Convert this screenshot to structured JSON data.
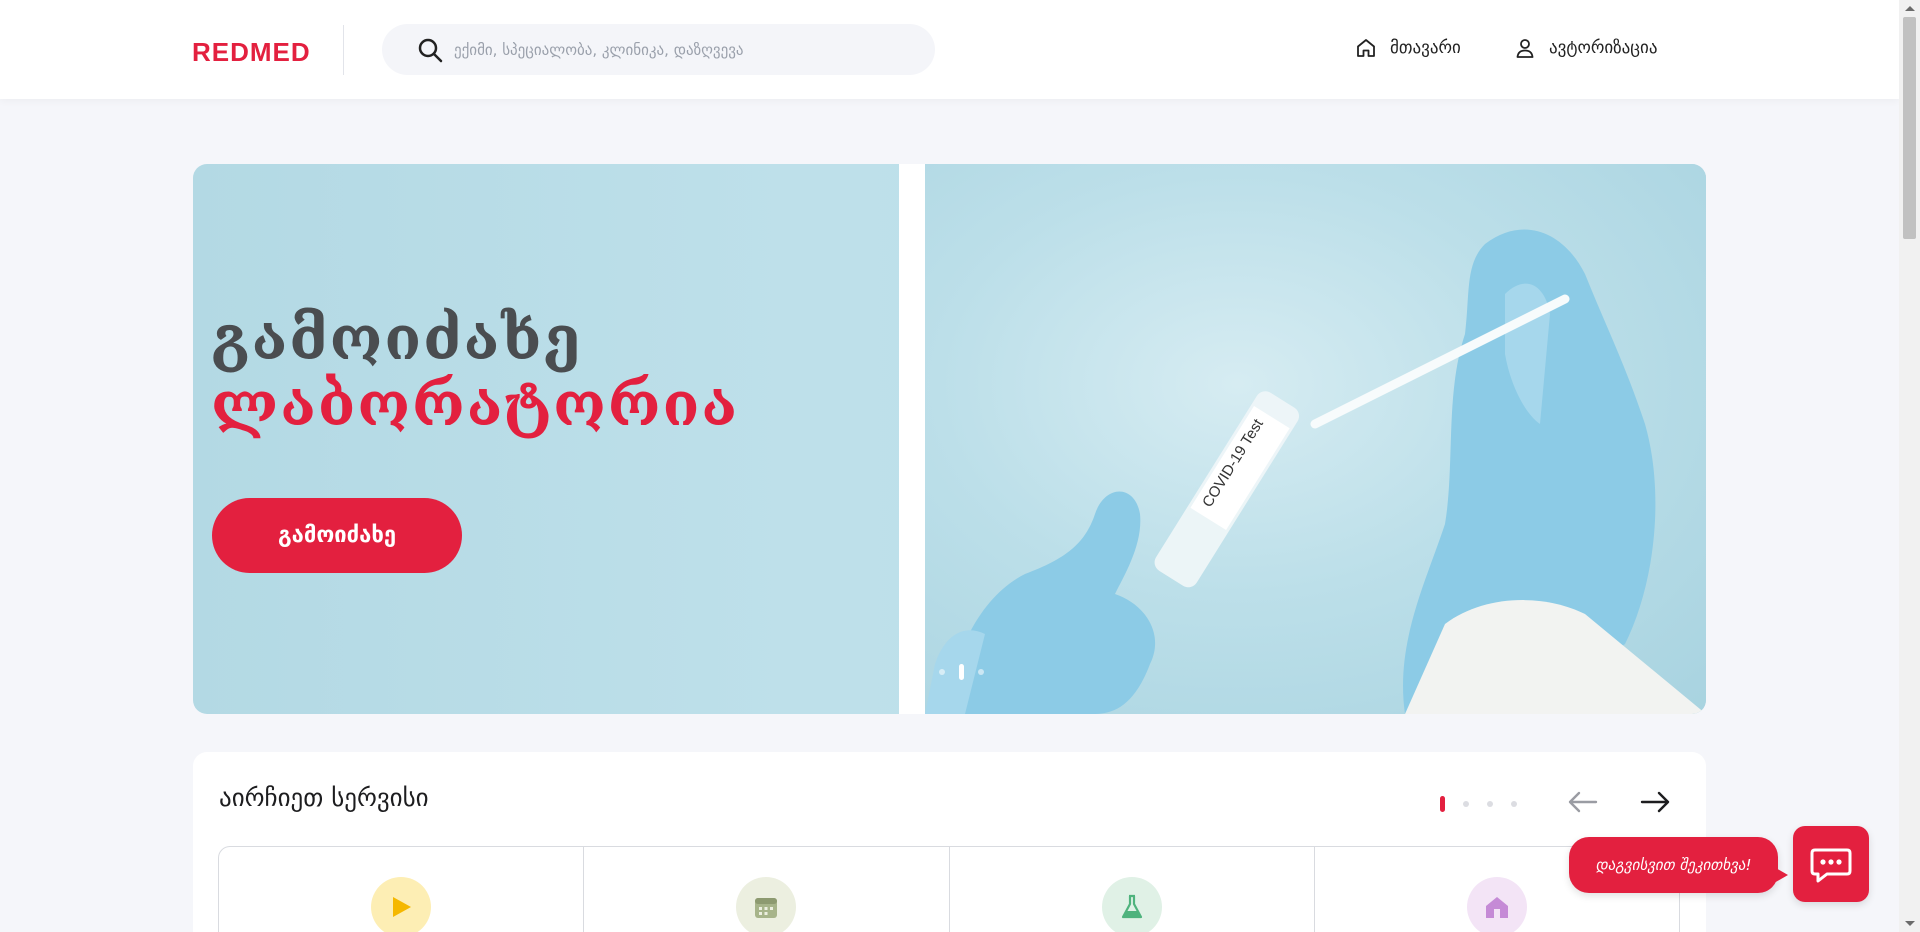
{
  "header": {
    "logo": "REDMED",
    "search": {
      "placeholder": "ექიმი, სპეციალობა, კლინიკა, დაზღვევა",
      "icon": "search-icon"
    },
    "nav": [
      {
        "label": "მთავარი",
        "icon": "home-icon"
      },
      {
        "label": "ავტორიზაცია",
        "icon": "user-icon"
      }
    ]
  },
  "hero": {
    "title_line_1": "გამოიძახე",
    "title_line_2": "ლაბორატორია",
    "button_label": "გამოიძახე",
    "slide_count": 3,
    "active_slide": 2,
    "photo_caption": "COVID-19 Test"
  },
  "services": {
    "title": "აირჩიეთ სერვისი",
    "page_count": 4,
    "active_page": 1,
    "cards": [
      {
        "icon": "play-icon",
        "color": "#f6c84c"
      },
      {
        "icon": "calendar-icon",
        "color": "#a7b48a"
      },
      {
        "icon": "flask-icon",
        "color": "#4fb37d"
      },
      {
        "icon": "house-icon",
        "color": "#c58ad6"
      }
    ]
  },
  "chat": {
    "bubble_text": "დაგვისვით შეკითხვა!",
    "icon": "chat-icon"
  },
  "colors": {
    "accent": "#e3203f",
    "dark_text": "#4a4d50",
    "background": "#f5f6fa"
  }
}
